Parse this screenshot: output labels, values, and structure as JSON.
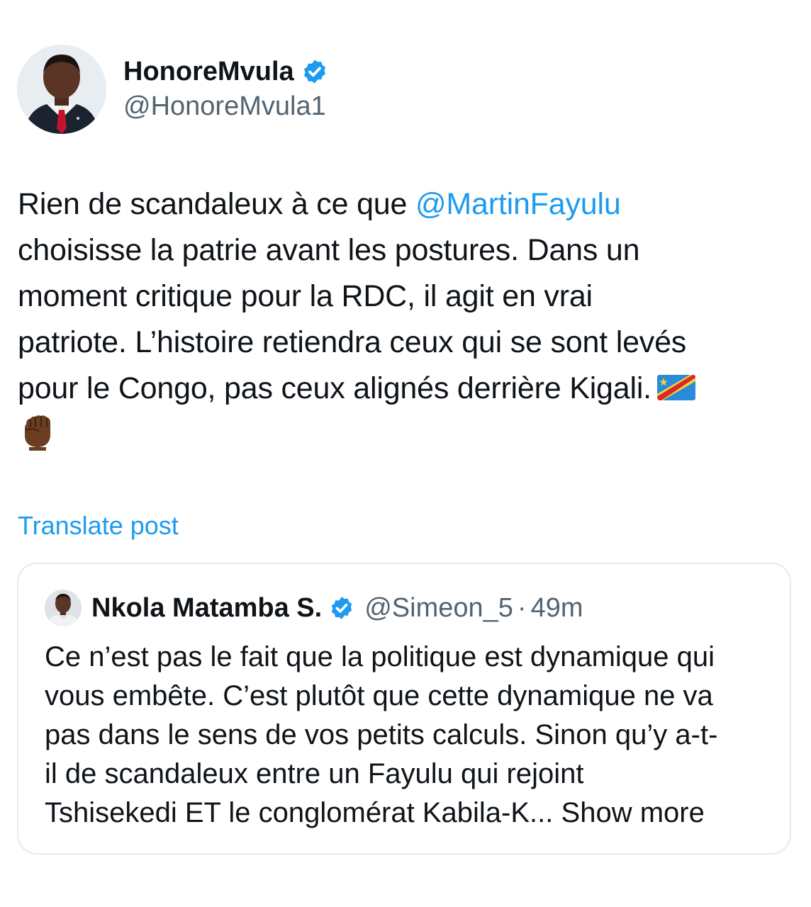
{
  "author": {
    "display_name": "HonoreMvula",
    "handle": "@HonoreMvula1",
    "verified": true
  },
  "post": {
    "lines": [
      {
        "before": "Rien de scandaleux à ce que ",
        "mention": "@MartinFayulu"
      },
      {
        "text": "choisisse la patrie avant les postures. Dans un"
      },
      {
        "text": "moment critique pour la RDC, il agit en vrai"
      },
      {
        "text": "patriote. L’histoire retiendra ceux qui se sont levés"
      },
      {
        "text": "pour le Congo, pas ceux alignés derrière Kigali."
      }
    ],
    "emoji": [
      "flag-drc-icon",
      "raised-fist-icon"
    ]
  },
  "translate_label": "Translate post",
  "quote": {
    "display_name": "Nkola Matamba S.",
    "handle": "@Simeon_5",
    "separator": "·",
    "time": "49m",
    "verified": true,
    "lines": [
      "Ce n’est pas le fait que la politique est dynamique qui",
      "vous embête. C’est plutôt que cette dynamique ne va",
      "pas dans le sens de vos petits calculs. Sinon qu’y a-t-",
      "il de scandaleux entre un Fayulu qui rejoint",
      "Tshisekedi ET le conglomérat Kabila-K..."
    ],
    "show_more": "Show more"
  },
  "colors": {
    "link": "#1d9bf0",
    "text": "#0f1419",
    "secondary": "#536471",
    "border": "#e6e9eb",
    "verified": "#1d9bf0"
  }
}
